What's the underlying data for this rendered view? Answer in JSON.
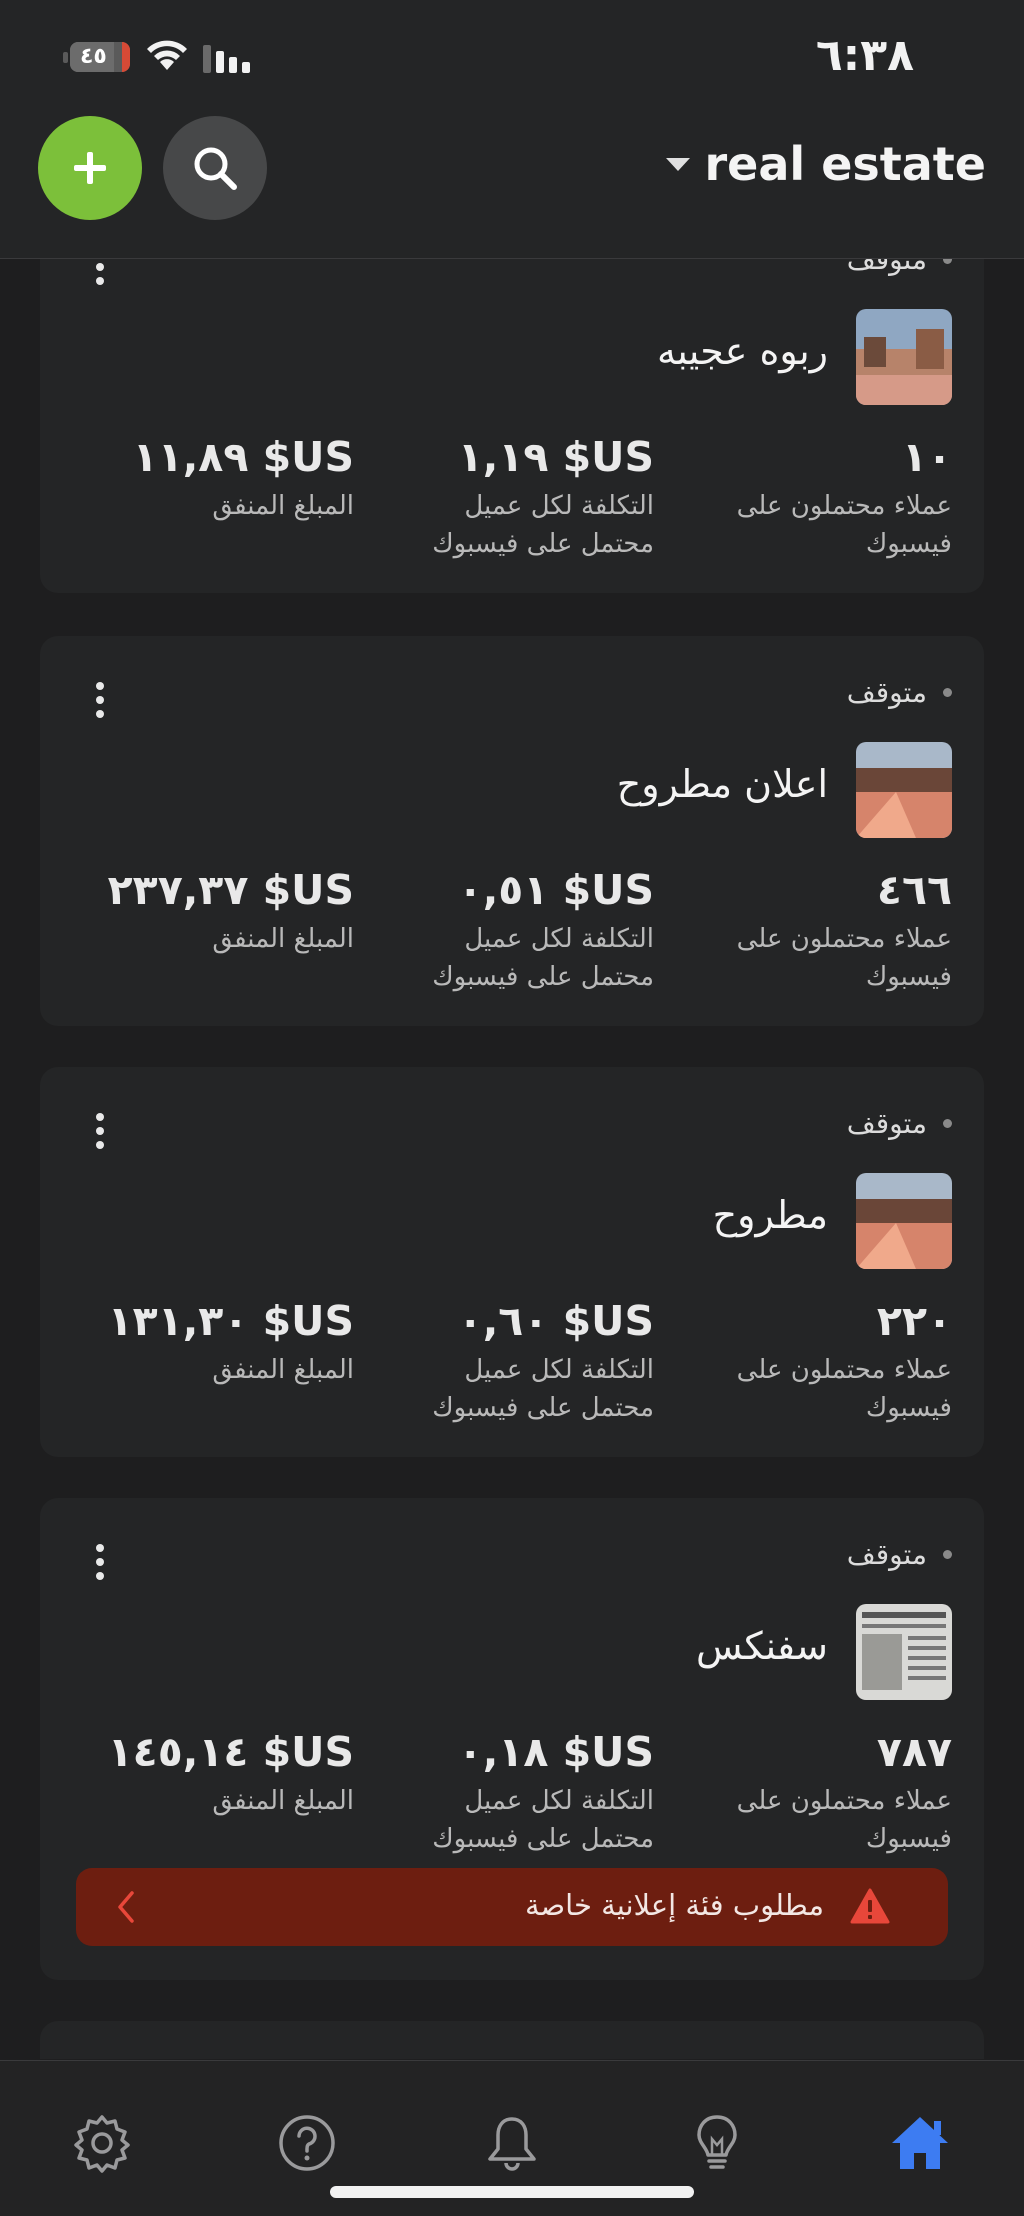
{
  "status_bar": {
    "time": "٦:٣٨",
    "battery_level": "٤٥"
  },
  "header": {
    "account_name": "real estate",
    "add_icon": "plus-icon",
    "search_icon": "search-icon"
  },
  "ads": [
    {
      "status": "متوقف",
      "name": "ربوه عجيبه",
      "leads_value": "١٠",
      "leads_label": "عملاء محتملون على فيسبوك",
      "cost_value": "US$ ١,١٩",
      "cost_label": "التكلفة لكل عميل محتمل على فيسبوك",
      "spent_value": "US$ ١١,٨٩",
      "spent_label": "المبلغ المنفق"
    },
    {
      "status": "متوقف",
      "name": "اعلان مطروح",
      "leads_value": "٤٦٦",
      "leads_label": "عملاء محتملون على فيسبوك",
      "cost_value": "US$ ٠,٥١",
      "cost_label": "التكلفة لكل عميل محتمل على فيسبوك",
      "spent_value": "US$ ٢٣٧,٣٧",
      "spent_label": "المبلغ المنفق"
    },
    {
      "status": "متوقف",
      "name": "مطروح",
      "leads_value": "٢٢٠",
      "leads_label": "عملاء محتملون على فيسبوك",
      "cost_value": "US$ ٠,٦٠",
      "cost_label": "التكلفة لكل عميل محتمل على فيسبوك",
      "spent_value": "US$ ١٣١,٣٠",
      "spent_label": "المبلغ المنفق"
    },
    {
      "status": "متوقف",
      "name": "سفنكس",
      "leads_value": "٧٨٧",
      "leads_label": "عملاء محتملون على فيسبوك",
      "cost_value": "US$ ٠,١٨",
      "cost_label": "التكلفة لكل عميل محتمل على فيسبوك",
      "spent_value": "US$ ١٤٥,١٤",
      "spent_label": "المبلغ المنفق",
      "warning": "مطلوب فئة إعلانية خاصة"
    }
  ],
  "tabs": [
    {
      "icon": "gear-icon"
    },
    {
      "icon": "help-icon"
    },
    {
      "icon": "bell-icon"
    },
    {
      "icon": "lightbulb-icon"
    },
    {
      "icon": "home-icon",
      "active": true
    }
  ],
  "colors": {
    "accent_green": "#7cc03a",
    "active_tab": "#3d7cf2",
    "warning_bg": "#6d1e10",
    "warning_icon": "#e8473a"
  }
}
